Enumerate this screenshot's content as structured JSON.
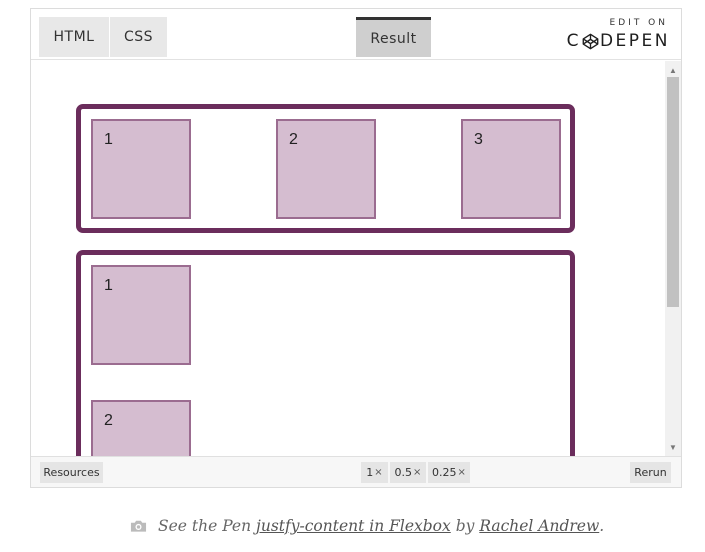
{
  "toolbar": {
    "tabs": [
      "HTML",
      "CSS",
      "Result"
    ],
    "edit_on": "EDIT ON",
    "brand_left": "C",
    "brand_right": "DEPEN"
  },
  "result": {
    "row_items": [
      "1",
      "2",
      "3"
    ],
    "column_items": [
      "1",
      "2"
    ]
  },
  "footer": {
    "resources": "Resources",
    "zoom": [
      {
        "value": "1",
        "suffix": "×"
      },
      {
        "value": "0.5",
        "suffix": "×"
      },
      {
        "value": "0.25",
        "suffix": "×"
      }
    ],
    "rerun": "Rerun"
  },
  "caption": {
    "prefix": "See the Pen ",
    "pen_title": "justfy-content in Flexbox",
    "by": " by ",
    "author": "Rachel Andrew",
    "end": "."
  },
  "colors": {
    "container_border": "#6b2d5c",
    "item_fill": "#d5bdd0",
    "item_border": "#9b6c90"
  },
  "icons": [
    "codepen-logo-icon",
    "scroll-up-icon",
    "scroll-down-icon",
    "camera-icon"
  ]
}
